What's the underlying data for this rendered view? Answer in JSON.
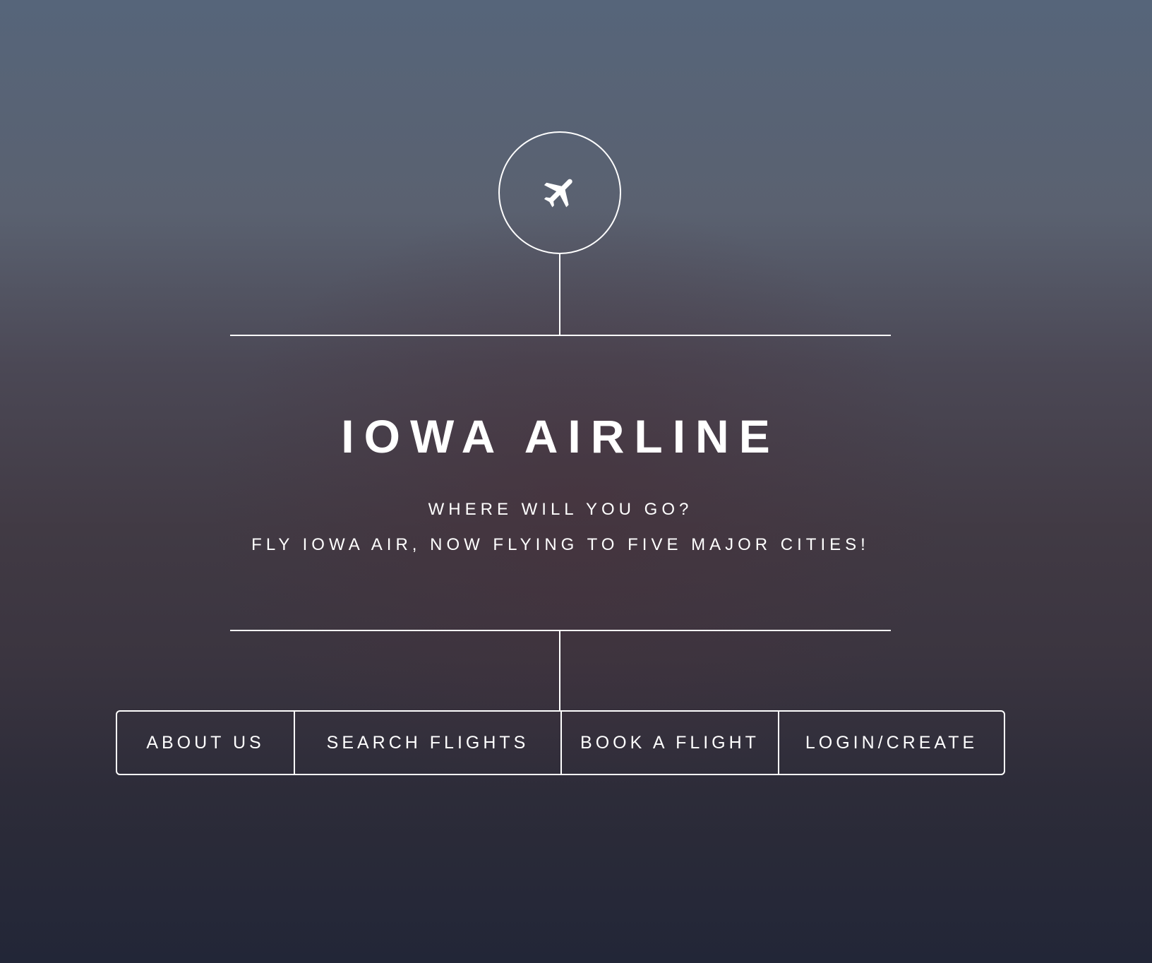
{
  "hero": {
    "title": "IOWA AIRLINE",
    "tagline_1": "WHERE WILL YOU GO?",
    "tagline_2": "FLY IOWA AIR, NOW FLYING TO FIVE MAJOR CITIES!",
    "logo_icon": "airplane-icon"
  },
  "nav": {
    "items": [
      {
        "label": "ABOUT US"
      },
      {
        "label": "SEARCH FLIGHTS"
      },
      {
        "label": "BOOK A FLIGHT"
      },
      {
        "label": "LOGIN/CREATE"
      }
    ]
  },
  "colors": {
    "text": "#ffffff",
    "lines": "#ffffff",
    "background_top": "#56657a",
    "background_bottom": "#222637"
  }
}
